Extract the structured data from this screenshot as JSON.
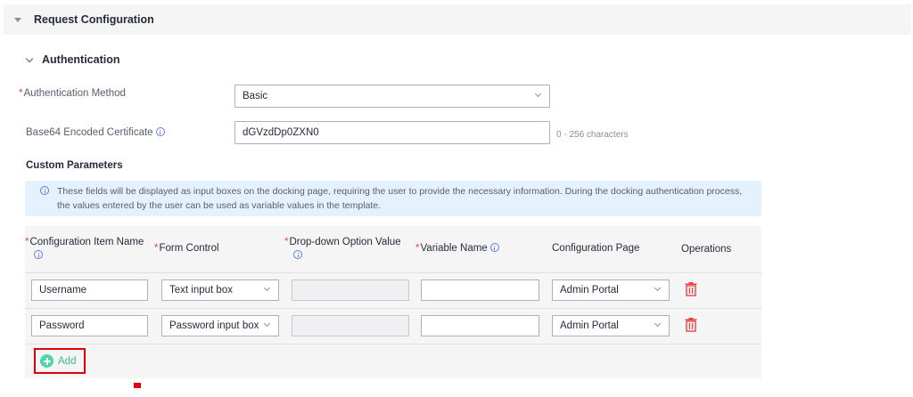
{
  "section": {
    "title": "Request Configuration"
  },
  "auth": {
    "title": "Authentication",
    "method_label": "Authentication Method",
    "method_value": "Basic",
    "cert_label": "Base64 Encoded Certificate",
    "cert_value": "dGVzdDp0ZXN0",
    "cert_hint": "0 - 256 characters"
  },
  "custom": {
    "title": "Custom Parameters",
    "notice": "These fields will be displayed as input boxes on the docking page, requiring the user to provide the necessary information. During the docking authentication process, the values entered by the user can be used as variable values in the template."
  },
  "table": {
    "columns": {
      "item_name": "Configuration Item Name",
      "form_control": "Form Control",
      "option_value": "Drop-down Option Value",
      "variable_name": "Variable Name",
      "config_page": "Configuration Page",
      "operations": "Operations"
    },
    "rows": [
      {
        "item_name": "Username",
        "form_control": "Text input box",
        "option_value": "",
        "variable_name": "",
        "config_page": "Admin Portal"
      },
      {
        "item_name": "Password",
        "form_control": "Password input box",
        "option_value": "",
        "variable_name": "",
        "config_page": "Admin Portal"
      }
    ],
    "add_label": "Add"
  },
  "colors": {
    "required": "#e54545",
    "add_green": "#50d4ab",
    "delete_red": "#e54545",
    "highlight": "#e0000b",
    "notice_bg": "#e6f1fe"
  },
  "icons": [
    "caret-down-icon",
    "chevron-down-icon",
    "info-icon",
    "trash-icon",
    "add-circle-icon"
  ]
}
